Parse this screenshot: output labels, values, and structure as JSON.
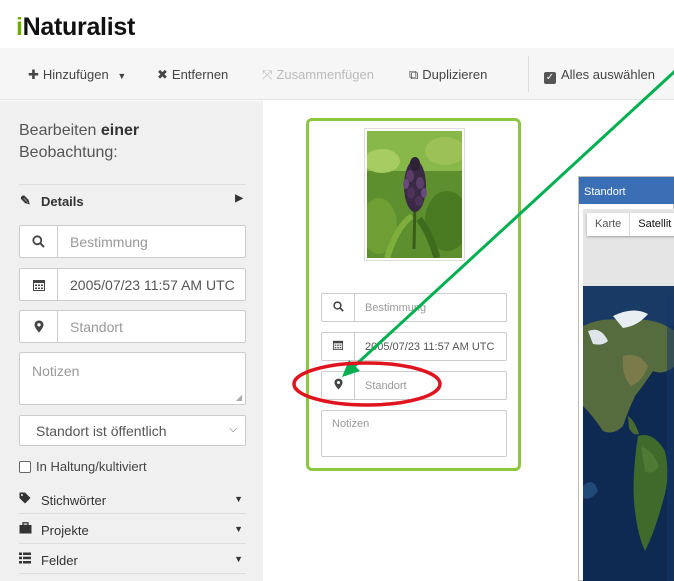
{
  "app": {
    "logo_text": "Naturalist",
    "logo_i": "i",
    "brand_green": "#74ac00"
  },
  "toolbar": {
    "add_label": "Hinzufügen",
    "remove_label": "Entfernen",
    "merge_label": "Zusammenfügen",
    "duplicate_label": "Duplizieren",
    "select_all_label": "Alles auswählen"
  },
  "sidebar": {
    "title_prefix": "Bearbeiten",
    "title_bold": "einer",
    "title_suffix": "Beobachtung:",
    "details_label": "Details",
    "identification_placeholder": "Bestimmung",
    "date_value": "2005/07/23 11:57 AM UTC",
    "location_placeholder": "Standort",
    "notes_placeholder": "Notizen",
    "geoprivacy_value": "Standort ist öffentlich",
    "captive_label": "In Haltung/kultiviert",
    "tags_label": "Stichwörter",
    "projects_label": "Projekte",
    "fields_label": "Felder"
  },
  "card": {
    "identification_placeholder": "Bestimmung",
    "date_value": "2005/07/23 11:57 AM UTC",
    "location_placeholder": "Standort",
    "notes_placeholder": "Notizen",
    "border_color": "#8dc63f"
  },
  "map": {
    "title": "Standort",
    "tab_map": "Karte",
    "tab_satellite": "Satellit",
    "header_color": "#3a6fb5"
  },
  "annotations": {
    "arrow_color": "#00b050",
    "circle_color": "#e0141e"
  }
}
